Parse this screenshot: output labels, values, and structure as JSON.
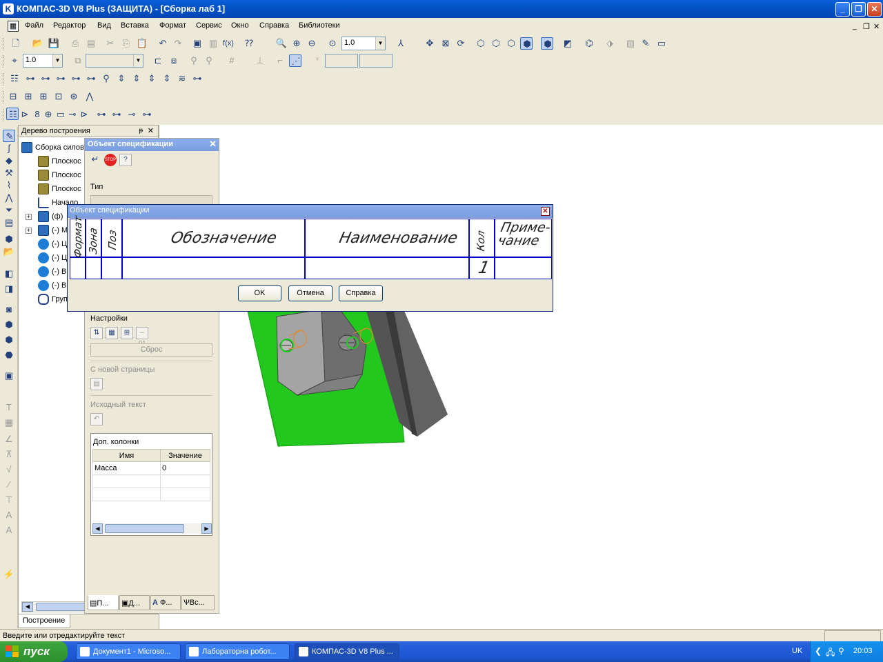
{
  "window": {
    "title": "КОМПАС-3D V8 Plus (ЗАЩИТА) - [Сборка лаб 1]",
    "buttons": {
      "minimize": "_",
      "maximize": "❐",
      "close": "✕"
    }
  },
  "menu": {
    "items": [
      "Файл",
      "Редактор",
      "Вид",
      "Вставка",
      "Формат",
      "Сервис",
      "Окно",
      "Справка",
      "Библиотеки"
    ],
    "mdi_buttons": [
      "_",
      "❐",
      "✕"
    ]
  },
  "toolbar": {
    "zoom_value": "1.0",
    "step_value": "1.0"
  },
  "tree": {
    "header": "Дерево построения",
    "pin": "ᵽ",
    "close": "✕",
    "items": [
      {
        "label": "Сборка силов",
        "icon": "assembly-icon"
      },
      {
        "label": "Плоскос",
        "icon": "plane-icon"
      },
      {
        "label": "Плоскос",
        "icon": "plane-icon"
      },
      {
        "label": "Плоскос",
        "icon": "plane-icon"
      },
      {
        "label": "Начало",
        "icon": "origin-icon"
      },
      {
        "label": "(ф)",
        "icon": "part-icon"
      },
      {
        "label": "(-) M",
        "icon": "part-icon"
      },
      {
        "label": "(-) Ц",
        "icon": "fastener-icon"
      },
      {
        "label": "(-) Ц",
        "icon": "fastener-icon"
      },
      {
        "label": "(-) В",
        "icon": "fastener-icon"
      },
      {
        "label": "(-) В",
        "icon": "fastener-icon"
      },
      {
        "label": "Груп",
        "icon": "group-icon"
      }
    ],
    "tab_label": "Построение"
  },
  "props": {
    "title": "Объект спецификации",
    "type_label": "Тип",
    "settings_label": "Настройки",
    "reset_label": "Сброс",
    "new_page_label": "С новой страницы",
    "source_text_label": "Исходный текст",
    "extra_columns": {
      "title": "Доп. колонки",
      "headers": [
        "Имя",
        "Значение"
      ],
      "rows": [
        {
          "name": "Масса",
          "value": "0"
        }
      ]
    },
    "tabs": [
      "П...",
      "Д...",
      "Ф...",
      "Вс..."
    ]
  },
  "dialog": {
    "title": "Объект спецификации",
    "columns": {
      "format": "Формат",
      "zone": "Зона",
      "pos": "Поз",
      "designation": "Обозначение",
      "name": "Наименование",
      "qty": "Кол",
      "note_line1": "Приме-",
      "note_line2": "чание"
    },
    "row": {
      "qty": "1"
    },
    "buttons": {
      "ok": "OK",
      "cancel": "Отмена",
      "help": "Справка"
    }
  },
  "status": {
    "text": "Введите или отредактируйте текст"
  },
  "taskbar": {
    "start": "пуск",
    "tasks": [
      "Документ1 - Microso...",
      "Лабораторна робот...",
      "КОМПАС-3D V8 Plus ..."
    ],
    "lang": "UK",
    "clock": "20:03"
  }
}
